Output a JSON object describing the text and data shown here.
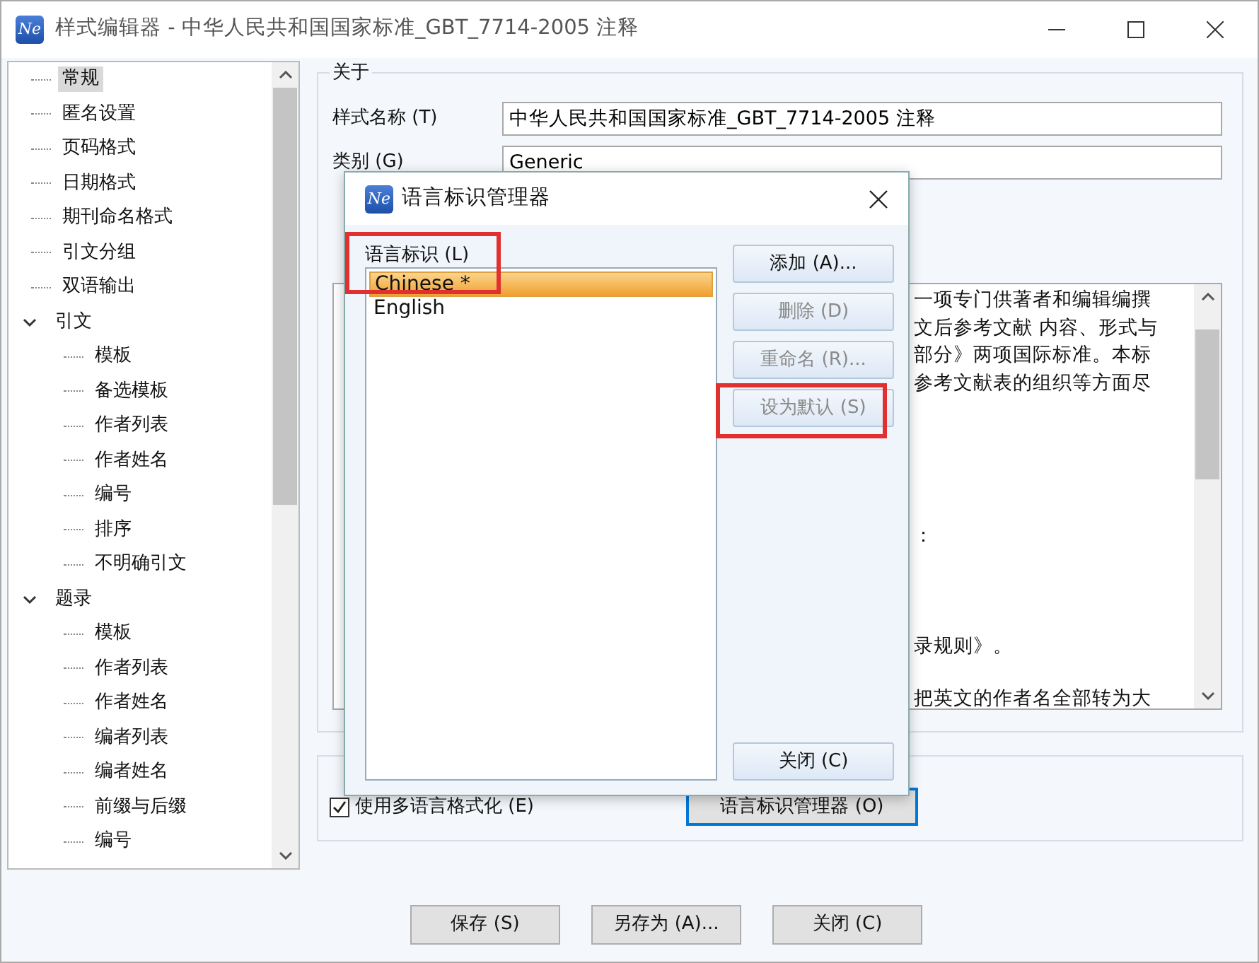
{
  "window": {
    "icon_text": "Ne",
    "title": "样式编辑器 - 中华人民共和国国家标准_GBT_7714-2005 注释"
  },
  "tree": [
    {
      "label": "常规",
      "selected": true
    },
    {
      "label": "匿名设置",
      "selected": false
    },
    {
      "label": "页码格式",
      "selected": false
    },
    {
      "label": "日期格式",
      "selected": false
    },
    {
      "label": "期刊命名格式",
      "selected": false
    },
    {
      "label": "引文分组",
      "selected": false
    },
    {
      "label": "双语输出",
      "selected": false
    },
    {
      "label": "引文",
      "selected": false,
      "expanded": true,
      "children": [
        {
          "label": "模板",
          "selected": false
        },
        {
          "label": "备选模板",
          "selected": false
        },
        {
          "label": "作者列表",
          "selected": false
        },
        {
          "label": "作者姓名",
          "selected": false
        },
        {
          "label": "编号",
          "selected": false
        },
        {
          "label": "排序",
          "selected": false
        },
        {
          "label": "不明确引文",
          "selected": false
        }
      ]
    },
    {
      "label": "题录",
      "selected": false,
      "expanded": true,
      "children": [
        {
          "label": "模板",
          "selected": false
        },
        {
          "label": "作者列表",
          "selected": false
        },
        {
          "label": "作者姓名",
          "selected": false
        },
        {
          "label": "编者列表",
          "selected": false
        },
        {
          "label": "编者姓名",
          "selected": false
        },
        {
          "label": "前缀与后缀",
          "selected": false
        },
        {
          "label": "编号",
          "selected": false
        }
      ]
    }
  ],
  "about": {
    "title": "关于",
    "fields": [
      {
        "label": "样式名称 (T)",
        "value": "中华人民共和国国家标准_GBT_7714-2005 注释"
      },
      {
        "label": "类别 (G)",
        "value": "Generic"
      }
    ],
    "notes_fragments": [
      "一项专门供著者和编辑编撰",
      "文后参考文献 内容、形式与",
      "部分》两项国际标准。本标",
      "参考文献表的组织等方面尽",
      "：",
      "录规则》。",
      "把英文的作者名全部转为大"
    ]
  },
  "multilang": {
    "checkbox": {
      "label": "使用多语言格式化 (E)",
      "checked": true
    },
    "button": "语言标识管理器 (O)"
  },
  "footer_buttons": [
    "保存 (S)",
    "另存为 (A)...",
    "关闭 (C)"
  ],
  "dialog": {
    "icon_text": "Ne",
    "title": "语言标识管理器",
    "list_label": "语言标识 (L)",
    "list_highlighted": true,
    "items": [
      {
        "label": "Chinese *",
        "selected": true
      },
      {
        "label": "English",
        "selected": false
      }
    ],
    "buttons": [
      {
        "label": "添加 (A)...",
        "disabled": false,
        "highlighted": false
      },
      {
        "label": "删除 (D)",
        "disabled": true,
        "highlighted": false
      },
      {
        "label": "重命名 (R)...",
        "disabled": true,
        "highlighted": false
      },
      {
        "label": "设为默认 (S)",
        "disabled": true,
        "highlighted": true
      }
    ],
    "close_button": "关闭 (C)"
  }
}
